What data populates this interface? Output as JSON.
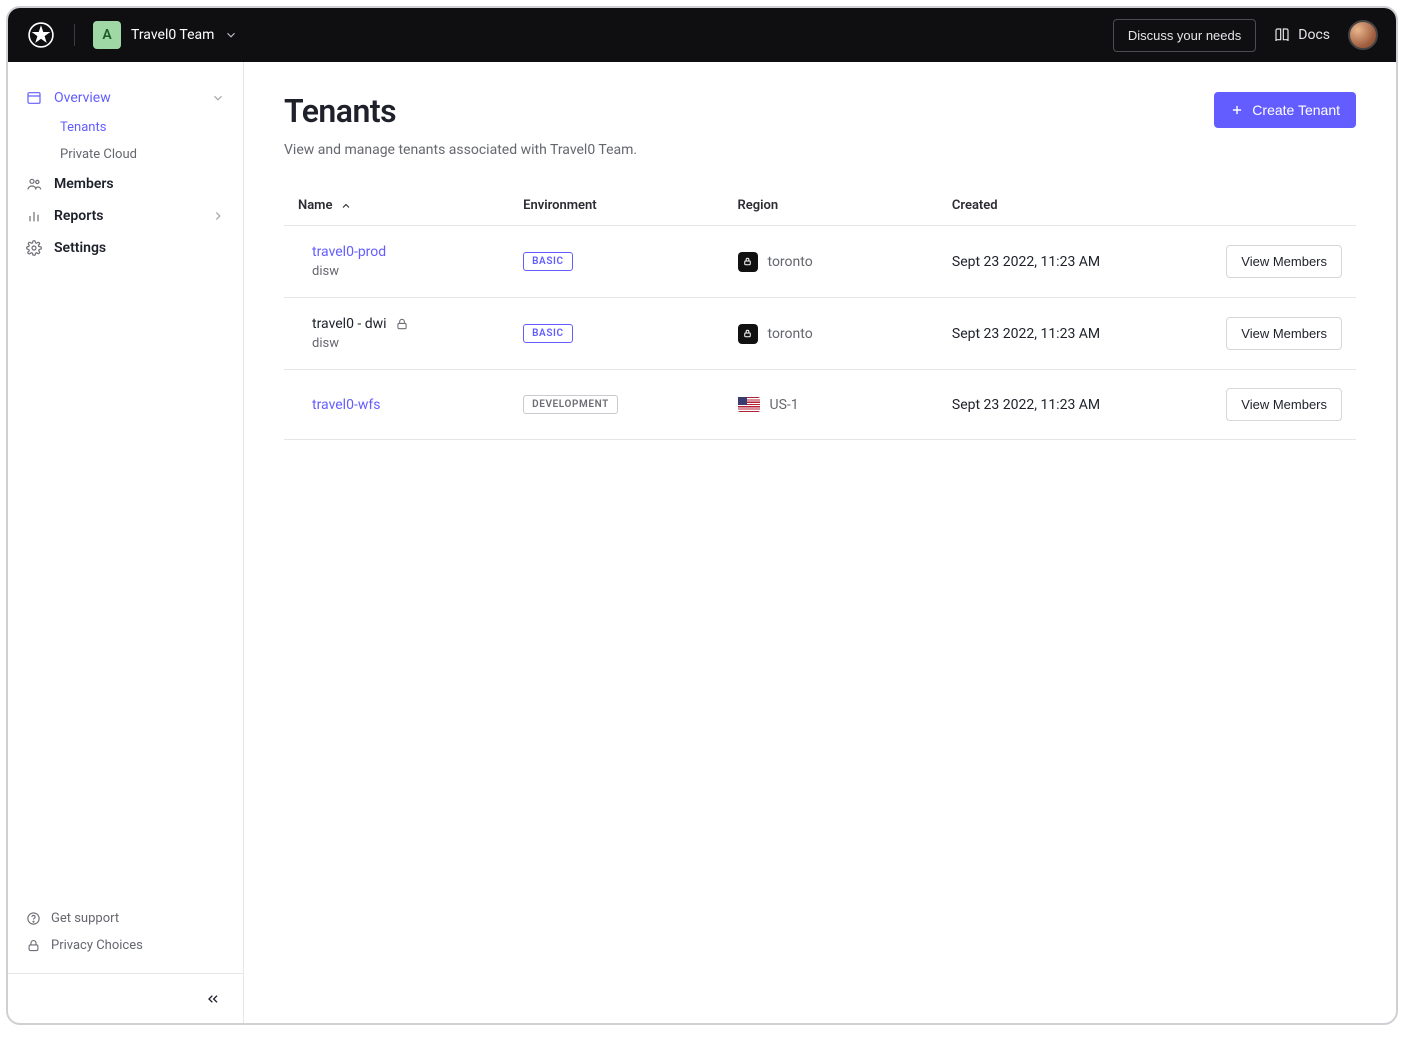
{
  "header": {
    "team_initial": "A",
    "team_name": "Travel0 Team",
    "discuss_label": "Discuss your needs",
    "docs_label": "Docs"
  },
  "sidebar": {
    "items": [
      {
        "label": "Overview",
        "active": true
      },
      {
        "label": "Members"
      },
      {
        "label": "Reports"
      },
      {
        "label": "Settings"
      }
    ],
    "overview_sub": [
      {
        "label": "Tenants",
        "active": true
      },
      {
        "label": "Private Cloud"
      }
    ],
    "support_label": "Get support",
    "privacy_label": "Privacy Choices"
  },
  "page": {
    "title": "Tenants",
    "subtitle": "View and manage tenants associated with Travel0 Team.",
    "create_label": "Create Tenant"
  },
  "table": {
    "headers": {
      "name": "Name",
      "environment": "Environment",
      "region": "Region",
      "created": "Created"
    },
    "view_members_label": "View Members",
    "rows": [
      {
        "name": "travel0-prod",
        "name_link": true,
        "sub": "disw",
        "locked": false,
        "env": "BASIC",
        "env_variant": "basic",
        "region": "toronto",
        "region_flag": "lock",
        "created": "Sept 23 2022, 11:23 AM"
      },
      {
        "name": "travel0 - dwi",
        "name_link": false,
        "sub": "disw",
        "locked": true,
        "env": "BASIC",
        "env_variant": "basic",
        "region": "toronto",
        "region_flag": "lock",
        "created": "Sept 23 2022, 11:23 AM"
      },
      {
        "name": "travel0-wfs",
        "name_link": true,
        "sub": "",
        "locked": false,
        "env": "DEVELOPMENT",
        "env_variant": "dev",
        "region": "US-1",
        "region_flag": "us",
        "created": "Sept 23 2022, 11:23 AM"
      }
    ]
  }
}
